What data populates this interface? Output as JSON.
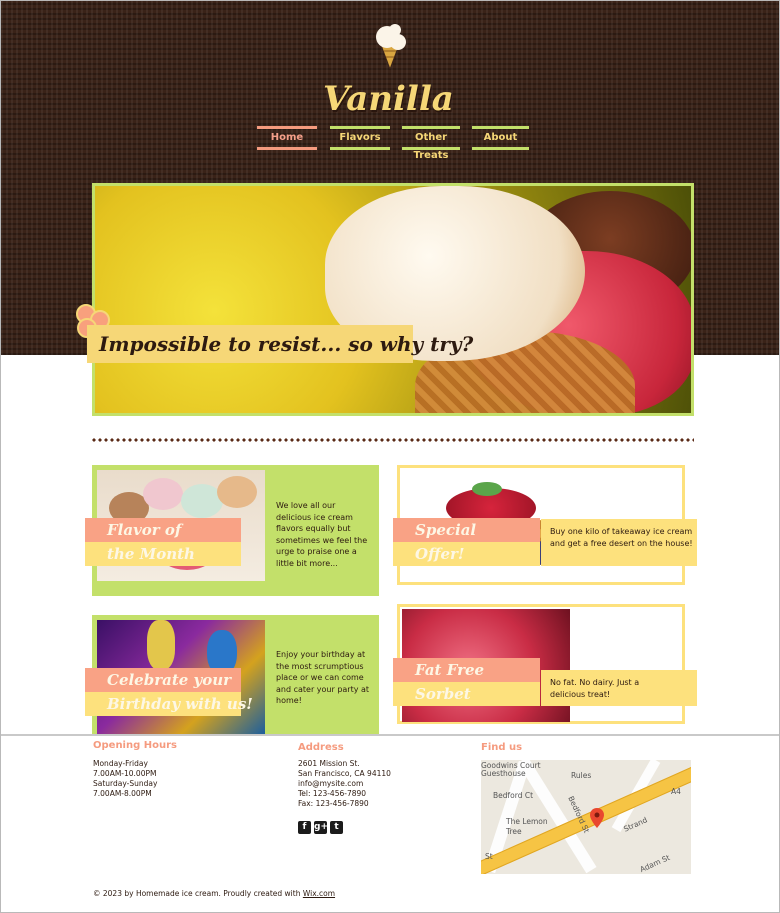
{
  "site": {
    "name": "Vanilla"
  },
  "nav": [
    {
      "label": "Home",
      "active": true
    },
    {
      "label": "Flavors",
      "active": false
    },
    {
      "label": "Other Treats",
      "active": false
    },
    {
      "label": "About",
      "active": false
    }
  ],
  "hero": {
    "caption": "Impossible to resist... so why try?"
  },
  "cards": {
    "flavor": {
      "line1": "Flavor of",
      "line2": "the Month",
      "text": "We love all our delicious ice cream flavors equally but sometimes we feel the urge to praise one a little bit more..."
    },
    "special": {
      "line1": "Special",
      "line2": "Offer!",
      "text": "Buy one kilo of takeaway ice cream and get a free desert on the house!"
    },
    "birthday": {
      "line1": "Celebrate your",
      "line2": "Birthday with us!",
      "text": "Enjoy your birthday at the most scrumptious place or we can come and cater your party at home!"
    },
    "sorbet": {
      "line1": "Fat Free",
      "line2": "Sorbet",
      "text": "No fat. No dairy. Just a delicious treat!"
    }
  },
  "footer": {
    "hours": {
      "title": "Opening Hours",
      "text": "Monday-Friday\n7.00AM-10.00PM\nSaturday-Sunday\n7.00AM-8.00PM"
    },
    "address": {
      "title": "Address",
      "text": "2601 Mission St.\nSan Francisco, CA 94110\ninfo@mysite.com\nTel: 123-456-7890\nFax: 123-456-7890"
    },
    "find": {
      "title": "Find us"
    },
    "social": [
      "f",
      "g+",
      "t"
    ],
    "map_labels": [
      "Goodwins Court",
      "Guesthouse",
      "Rules",
      "Bedford Ct",
      "The Lemon",
      "Tree",
      "Bedford St",
      "Strand",
      "A4",
      "Adam St",
      "St"
    ],
    "copyright_text": "© 2023 by Homemade ice cream. Proudly created with ",
    "copyright_link": "Wix.com"
  },
  "colors": {
    "brown": "#3a2318",
    "yellow": "#f6d777",
    "green": "#c3e06a",
    "pink": "#f9a285",
    "light_yellow": "#fde17d"
  }
}
